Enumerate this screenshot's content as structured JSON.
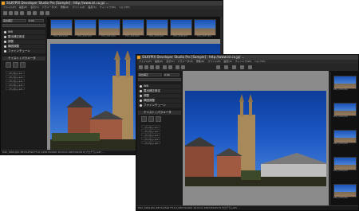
{
  "windows": [
    {
      "id": "back",
      "title": "SILKYPIX Developer Studio Pro [Sample] : http://www.isl.co.jp/ ...",
      "menus": [
        "ファイル(F)",
        "編集(E)",
        "表示(V)",
        "パラメータ(P)",
        "現像(D)",
        "プリント(P)",
        "設定(S)",
        "ウィンドウ(W)",
        "ヘルプ(H)"
      ],
      "exposure_label": "露出補正",
      "exposure_value": "0.00",
      "sections": [
        "WB",
        "カラー",
        "トーン",
        "ノイズ",
        "シャープ",
        "ファインチューン"
      ],
      "section_labels": [
        "ホワイトバランス",
        "露出補正設定",
        "調整",
        "構図調整",
        "ファインチューン"
      ],
      "palette_title": "テイスト / パラメータ",
      "presets": [
        "プリセット1",
        "プリセット2",
        "プリセット3",
        "プリセット4",
        "プリセット5"
      ],
      "thumbnails": [
        "DSC_0001.JPG",
        "DSC_0002.JPG",
        "DSC_0003.JPG",
        "DSC_0004.JPG",
        "DSC_0005.JPG",
        "DSC_0006.JPG",
        "DSC_0007.JPG"
      ],
      "status": "DSC_0001.JPG 3872x2592 F5.6 1/250 ISO200 16.0mm 2007/04/29 P(プログラムAE) ..."
    },
    {
      "id": "front",
      "title": "SILKYPIX Developer Studio Pro [Sample] : http://www.isl.co.jp/ ...",
      "menus": [
        "ファイル(F)",
        "編集(E)",
        "表示(V)",
        "パラメータ(P)",
        "現像(D)",
        "プリント(P)",
        "設定(S)",
        "ウィンドウ(W)",
        "ヘルプ(H)"
      ],
      "exposure_label": "露出補正",
      "exposure_value": "0.00",
      "sections": [
        "WB",
        "カラー",
        "トーン",
        "ノイズ",
        "シャープ",
        "ファインチューン"
      ],
      "section_labels": [
        "ホワイトバランス",
        "露出補正設定",
        "調整",
        "構図調整",
        "ファインチューン"
      ],
      "palette_title": "テイスト / パラメータ",
      "presets": [
        "プリセット1",
        "プリセット2",
        "プリセット3",
        "プリセット4",
        "プリセット5"
      ],
      "thumbnails": [
        "DSC_0001.JPG",
        "DSC_0002.JPG",
        "DSC_0003.JPG",
        "DSC_0004.JPG",
        "DSC_0005.JPG"
      ],
      "status": "DSC_0001.JPG 3872x2592 F5.6 1/250 ISO200 16.0mm 2007/04/29 P(プログラムAE) ..."
    }
  ],
  "colors": {
    "sky": "#1a56c4",
    "panel": "#1c1c1c",
    "accent": "#f0a020"
  },
  "icons": [
    "app-icon",
    "toolbar-icon",
    "palette-button-icon"
  ]
}
